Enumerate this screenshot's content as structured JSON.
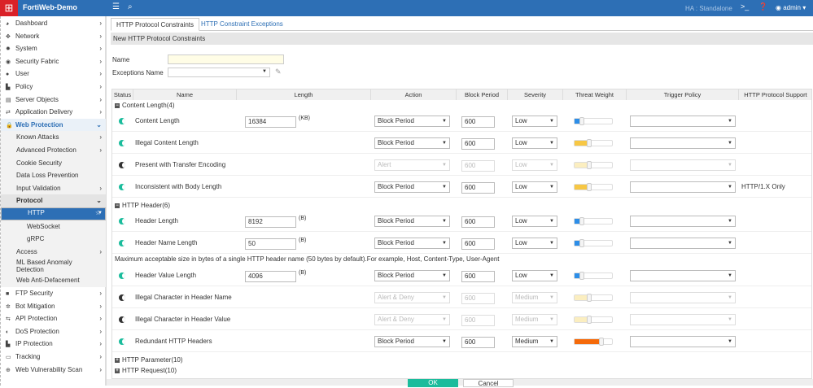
{
  "topbar": {
    "logo_icon": "fortinet-grid-icon",
    "title": "FortiWeb-Demo",
    "ha": "HA : Standalone",
    "user": "admin"
  },
  "sidebar": [
    {
      "label": "Dashboard",
      "icon": "◕",
      "kind": "top"
    },
    {
      "label": "Network",
      "icon": "✥",
      "kind": "top"
    },
    {
      "label": "System",
      "icon": "✹",
      "kind": "top"
    },
    {
      "label": "Security Fabric",
      "icon": "◉",
      "kind": "top"
    },
    {
      "label": "User",
      "icon": "●",
      "kind": "top"
    },
    {
      "label": "Policy",
      "icon": "▙",
      "kind": "top"
    },
    {
      "label": "Server Objects",
      "icon": "▤",
      "kind": "top"
    },
    {
      "label": "Application Delivery",
      "icon": "⇄",
      "kind": "top"
    },
    {
      "label": "Web Protection",
      "icon": "🔒",
      "kind": "open"
    },
    {
      "label": "Known Attacks",
      "kind": "sub"
    },
    {
      "label": "Advanced Protection",
      "kind": "sub"
    },
    {
      "label": "Cookie Security",
      "kind": "subn"
    },
    {
      "label": "Data Loss Prevention",
      "kind": "subn"
    },
    {
      "label": "Input Validation",
      "kind": "sub"
    },
    {
      "label": "Protocol",
      "kind": "subopen"
    },
    {
      "label": "HTTP",
      "kind": "sel"
    },
    {
      "label": "WebSocket",
      "kind": "sub2"
    },
    {
      "label": "gRPC",
      "kind": "sub2"
    },
    {
      "label": "Access",
      "kind": "sub"
    },
    {
      "label": "ML Based Anomaly Detection",
      "kind": "subtall"
    },
    {
      "label": "Web Anti-Defacement",
      "kind": "subn"
    },
    {
      "label": "FTP Security",
      "icon": "■",
      "kind": "top"
    },
    {
      "label": "Bot Mitigation",
      "icon": "✲",
      "kind": "top"
    },
    {
      "label": "API Protection",
      "icon": "⇆",
      "kind": "top"
    },
    {
      "label": "DoS Protection",
      "icon": "◐",
      "kind": "top"
    },
    {
      "label": "IP Protection",
      "icon": "▙",
      "kind": "top"
    },
    {
      "label": "Tracking",
      "icon": "▭",
      "kind": "top"
    },
    {
      "label": "Web Vulnerability Scan",
      "icon": "⊕",
      "kind": "top"
    }
  ],
  "tabs": [
    "HTTP Protocol Constraints",
    "HTTP Constraint Exceptions"
  ],
  "section_title": "New HTTP Protocol Constraints",
  "form": {
    "name_label": "Name",
    "name_value": "",
    "exceptions_label": "Exceptions Name",
    "exceptions_value": ""
  },
  "columns": [
    "Status",
    "Name",
    "Length",
    "Action",
    "Block Period",
    "Severity",
    "Threat Weight",
    "Trigger Policy",
    "HTTP Protocol Support"
  ],
  "groups": [
    {
      "label": "Content Length(4)",
      "expanded": true,
      "rows": [
        {
          "name": "Content Length",
          "on": true,
          "length": "16384",
          "unit": "(KB)",
          "action": "Block Period",
          "period": "600",
          "severity": "Low",
          "weight": 0.25,
          "color": "#2d8ee8",
          "support": ""
        },
        {
          "name": "Illegal Content Length",
          "on": true,
          "length": "",
          "unit": "",
          "action": "Block Period",
          "period": "600",
          "severity": "Low",
          "weight": 0.5,
          "color": "#f7c744",
          "support": ""
        },
        {
          "name": "Present with Transfer Encoding",
          "on": false,
          "length": "",
          "unit": "",
          "action": "Alert",
          "period": "600",
          "severity": "Low",
          "weight": 0.5,
          "color": "#fbeec0",
          "support": ""
        },
        {
          "name": "Inconsistent with Body Length",
          "on": true,
          "length": "",
          "unit": "",
          "action": "Block Period",
          "period": "600",
          "severity": "Low",
          "weight": 0.5,
          "color": "#f7c744",
          "support": "HTTP/1.X Only"
        }
      ]
    },
    {
      "label": "HTTP Header(6)",
      "expanded": true,
      "rows": [
        {
          "name": "Header Length",
          "on": true,
          "length": "8192",
          "unit": "(B)",
          "action": "Block Period",
          "period": "600",
          "severity": "Low",
          "weight": 0.25,
          "color": "#2d8ee8",
          "support": ""
        },
        {
          "name": "Header Name Length",
          "on": true,
          "length": "50",
          "unit": "(B)",
          "action": "Block Period",
          "period": "600",
          "severity": "Low",
          "weight": 0.25,
          "color": "#2d8ee8",
          "support": "",
          "desc": "Maximum acceptable size in bytes of a single HTTP header name (50 bytes by default).For example, Host, Content-Type, User-Agent"
        },
        {
          "name": "Header Value Length",
          "on": true,
          "length": "4096",
          "unit": "(B)",
          "action": "Block Period",
          "period": "600",
          "severity": "Low",
          "weight": 0.25,
          "color": "#2d8ee8",
          "support": ""
        },
        {
          "name": "Illegal Character in Header Name",
          "on": false,
          "length": "",
          "unit": "",
          "action": "Alert & Deny",
          "period": "600",
          "severity": "Medium",
          "weight": 0.5,
          "color": "#fbeec0",
          "support": ""
        },
        {
          "name": "Illegal Character in Header Value",
          "on": false,
          "length": "",
          "unit": "",
          "action": "Alert & Deny",
          "period": "600",
          "severity": "Medium",
          "weight": 0.5,
          "color": "#fbeec0",
          "support": ""
        },
        {
          "name": "Redundant HTTP Headers",
          "on": true,
          "length": "",
          "unit": "",
          "action": "Block Period",
          "period": "600",
          "severity": "Medium",
          "weight": 0.75,
          "color": "#f56a0a",
          "support": ""
        }
      ]
    },
    {
      "label": "HTTP Parameter(10)",
      "expanded": false,
      "rows": []
    },
    {
      "label": "HTTP Request(10)",
      "expanded": false,
      "rows": []
    }
  ],
  "buttons": {
    "ok": "OK",
    "cancel": "Cancel"
  }
}
